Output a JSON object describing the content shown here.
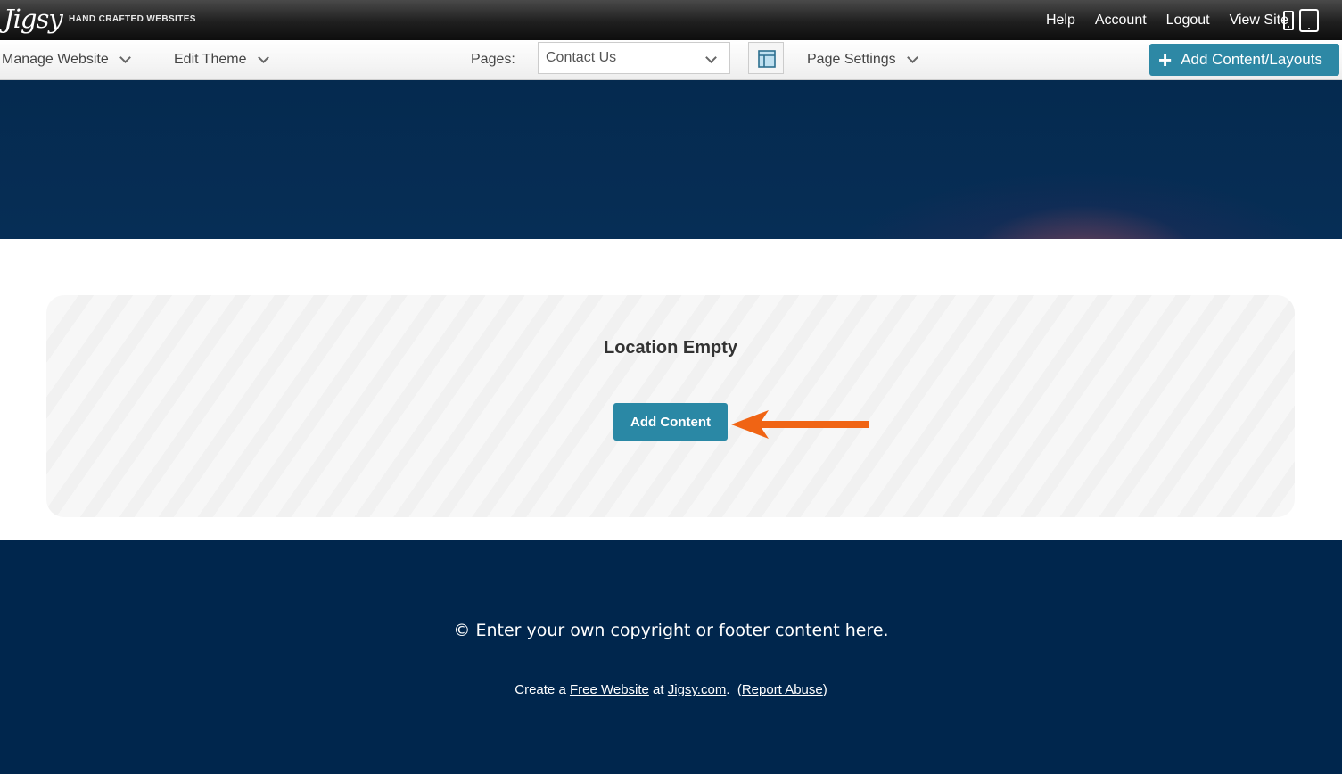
{
  "topbar": {
    "logo_text": "Jigsy",
    "tagline": "HAND CRAFTED WEBSITES",
    "links": {
      "help": "Help",
      "account": "Account",
      "logout": "Logout",
      "view_site": "View Site"
    }
  },
  "menubar": {
    "manage_website": "Manage Website",
    "edit_theme": "Edit Theme",
    "pages_label": "Pages:",
    "pages_selected": "Contact Us",
    "page_settings": "Page Settings",
    "add_content_layouts": "Add Content/Layouts"
  },
  "content": {
    "empty_title": "Location Empty",
    "add_content_button": "Add Content"
  },
  "footer": {
    "copyright": "© Enter your own copyright or footer content here.",
    "credit_prefix": "Create a ",
    "free_website_link": "Free Website",
    "credit_mid": " at ",
    "jigsy_link": "Jigsy.com",
    "credit_sep": ".  (",
    "report_abuse_link": "Report Abuse",
    "credit_suffix": ")"
  },
  "colors": {
    "accent": "#2d88a5",
    "footer_bg": "#00264d",
    "hero_bg": "#052a4f",
    "annotation_arrow": "#f06414"
  }
}
